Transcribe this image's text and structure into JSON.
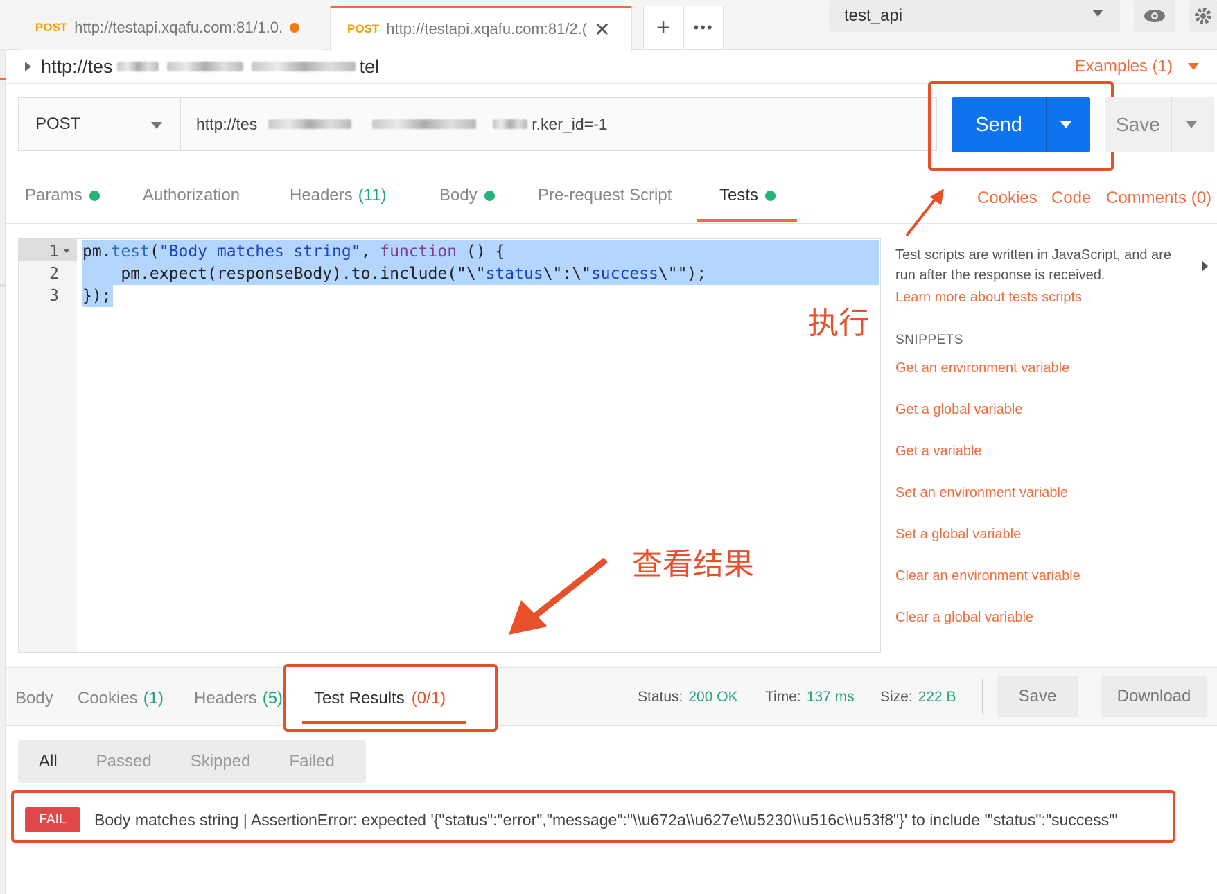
{
  "tabs": [
    {
      "method": "POST",
      "url": "http://testapi.xqafu.com:81/1.0."
    },
    {
      "method": "POST",
      "url": "http://testapi.xqafu.com:81/2.("
    }
  ],
  "icons": {
    "new_tab": "+",
    "more": "•••",
    "close": "✕"
  },
  "environment": {
    "selected": "test_api"
  },
  "breadcrumb": {
    "prefix": "http://tes",
    "suffix": "tel"
  },
  "examples": {
    "label": "Examples (1)"
  },
  "request": {
    "method": "POST",
    "url_prefix": "http://tes",
    "url_suffix": "r.ker_id=-1",
    "send_label": "Send",
    "save_label": "Save"
  },
  "request_tabs": [
    {
      "label": "Params",
      "dot": true
    },
    {
      "label": "Authorization"
    },
    {
      "label": "Headers",
      "count": "(11)"
    },
    {
      "label": "Body",
      "dot": true
    },
    {
      "label": "Pre-request Script"
    },
    {
      "label": "Tests",
      "dot": true,
      "active": true
    }
  ],
  "right_links": {
    "cookies": "Cookies",
    "code": "Code",
    "comments": "Comments (0)"
  },
  "editor": {
    "line_numbers": [
      "1",
      "2",
      "3"
    ],
    "lines": [
      "pm.test(\"Body matches string\", function () {",
      "    pm.expect(responseBody).to.include(\"\\\"status\\\":\\\"success\\\"\");",
      "});"
    ]
  },
  "tests_panel": {
    "description": "Test scripts are written in JavaScript, and are run after the response is received.",
    "learn_more": "Learn more about tests scripts",
    "snippets_title": "SNIPPETS",
    "snippets": [
      "Get an environment variable",
      "Get a global variable",
      "Get a variable",
      "Set an environment variable",
      "Set a global variable",
      "Clear an environment variable",
      "Clear a global variable"
    ]
  },
  "annotations": {
    "execute": "执行",
    "view_results": "查看结果"
  },
  "response_tabs": [
    {
      "label": "Body"
    },
    {
      "label": "Cookies",
      "count": "(1)"
    },
    {
      "label": "Headers",
      "count": "(5)"
    },
    {
      "label": "Test Results",
      "count": "(0/1)",
      "active": true
    }
  ],
  "status": {
    "status_label": "Status:",
    "status_value": "200 OK",
    "time_label": "Time:",
    "time_value": "137 ms",
    "size_label": "Size:",
    "size_value": "222 B"
  },
  "response_buttons": {
    "save": "Save",
    "download": "Download"
  },
  "filters": [
    "All",
    "Passed",
    "Skipped",
    "Failed"
  ],
  "result": {
    "badge": "FAIL",
    "message": "Body matches string | AssertionError: expected '{\"status\":\"error\",\"message\":\"\\\\u672a\\\\u627e\\\\u5230\\\\u516c\\\\u53f8\"}' to include '\"status\":\"success\"'"
  },
  "colors": {
    "accent": "#f26b3a",
    "send_blue": "#0f73ee",
    "highlight_red": "#e8502a",
    "success_green": "#1fa37a",
    "fail_red": "#e0484b"
  }
}
